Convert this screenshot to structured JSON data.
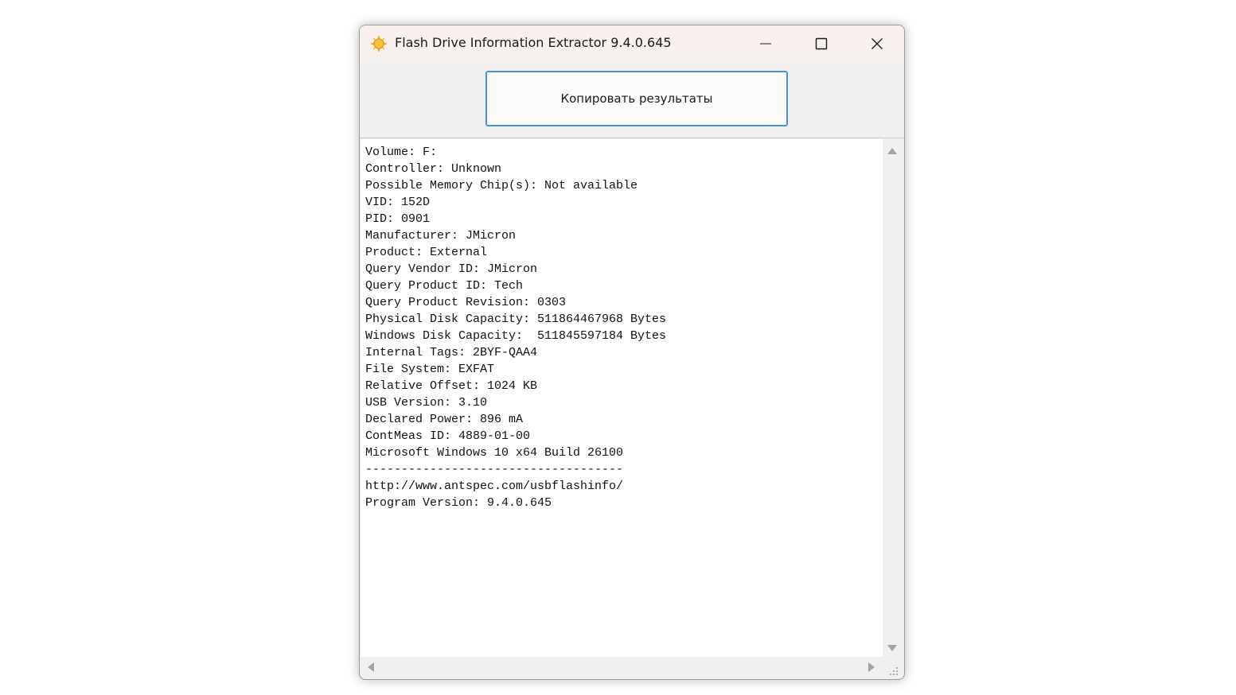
{
  "window": {
    "title": "Flash Drive Information Extractor 9.4.0.645",
    "icon": "sun-icon",
    "controls": {
      "minimize_icon": "minimize-icon",
      "maximize_icon": "maximize-icon",
      "close_icon": "close-icon"
    }
  },
  "toolbar": {
    "copy_label": "Копировать результаты"
  },
  "results": {
    "lines": [
      "Volume: F:",
      "Controller: Unknown",
      "Possible Memory Chip(s): Not available",
      "VID: 152D",
      "PID: 0901",
      "Manufacturer: JMicron",
      "Product: External",
      "Query Vendor ID: JMicron",
      "Query Product ID: Tech",
      "Query Product Revision: 0303",
      "Physical Disk Capacity: 511864467968 Bytes",
      "Windows Disk Capacity:  511845597184 Bytes",
      "Internal Tags: 2BYF-QAA4",
      "File System: EXFAT",
      "Relative Offset: 1024 KB",
      "USB Version: 3.10",
      "Declared Power: 896 mA",
      "ContMeas ID: 4889-01-00",
      "Microsoft Windows 10 x64 Build 26100",
      "------------------------------------",
      "http://www.antspec.com/usbflashinfo/",
      "Program Version: 9.4.0.645"
    ]
  },
  "colors": {
    "titlebar_bg": "#f8f0ec",
    "button_border": "#4a90d9",
    "client_bg": "#f0f0f0",
    "text_bg": "#ffffff"
  }
}
